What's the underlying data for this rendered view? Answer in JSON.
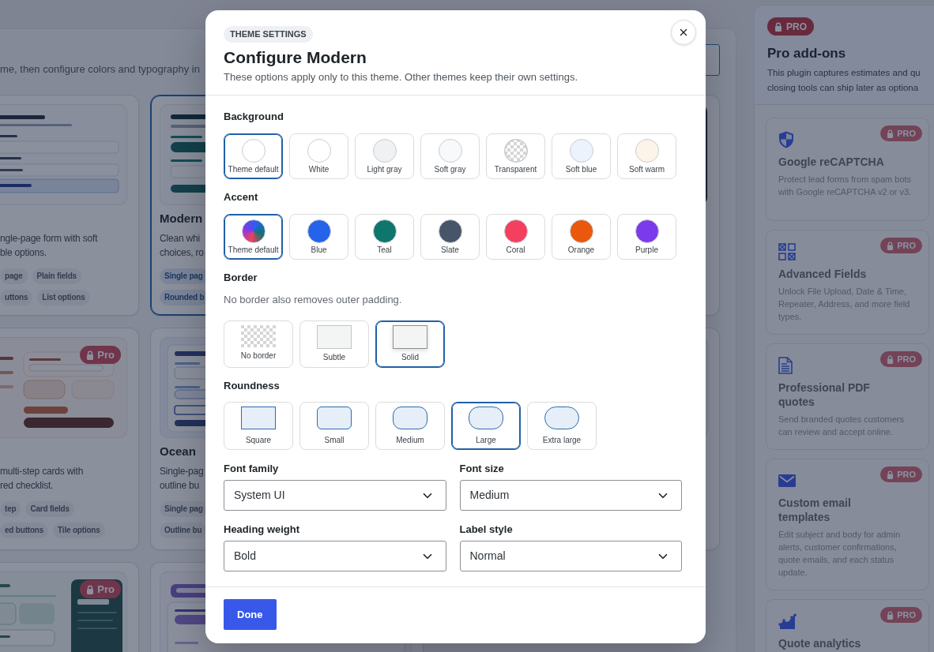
{
  "main_panel": {
    "intro": "me, then configure colors and typography in",
    "theme_cards": [
      {
        "kind": "plain",
        "selected": false,
        "description": "ngle-page form with soft\nble options.",
        "tag_rows": [
          [
            "page",
            "Plain fields"
          ],
          [
            "uttons",
            "List options"
          ]
        ]
      },
      {
        "kind": "modern",
        "selected": true,
        "title": "Modern",
        "description": "Clean whi\nchoices, ro",
        "tag_rows": [
          [
            "Single pag"
          ],
          [
            "Rounded b"
          ]
        ]
      },
      {
        "kind": "dark",
        "selected": false
      },
      {
        "kind": "warm",
        "selected": false,
        "badge": "Pro",
        "description": "multi-step cards with\nred checklist.",
        "tag_rows": [
          [
            "tep",
            "Card fields"
          ],
          [
            "ed buttons",
            "Tile options"
          ]
        ]
      },
      {
        "kind": "ocean",
        "selected": false,
        "title": "Ocean",
        "description": "Single-pag\noutline bu",
        "tag_rows": [
          [
            "Single pag"
          ],
          [
            "Outline bu"
          ]
        ]
      },
      {
        "kind": "light",
        "selected": false
      },
      {
        "kind": "green",
        "selected": false,
        "badge": "Pro"
      },
      {
        "kind": "purple",
        "selected": false
      }
    ]
  },
  "pro_panel": {
    "badge": "PRO",
    "title": "Pro add-ons",
    "description": "This plugin captures estimates and qu\nclosing tools can ship later as optiona",
    "addons": [
      {
        "badge": "PRO",
        "title": "Google reCAPTCHA",
        "description": "Protect lead forms from spam bots with Google reCAPTCHA v2 or v3."
      },
      {
        "badge": "PRO",
        "title": "Advanced Fields",
        "description": "Unlock File Upload, Date & Time, Repeater, Address, and more field types."
      },
      {
        "badge": "PRO",
        "title": "Professional PDF quotes",
        "description": "Send branded quotes customers can review and accept online."
      },
      {
        "badge": "PRO",
        "title": "Custom email templates",
        "description": "Edit subject and body for admin alerts, customer confirmations, quote emails, and each status update."
      },
      {
        "badge": "PRO",
        "title": "Quote analytics"
      }
    ]
  },
  "modal": {
    "badge": "THEME SETTINGS",
    "title": "Configure Modern",
    "subtitle": "These options apply only to this theme. Other themes keep their own settings.",
    "sections": [
      {
        "kind": "swatches",
        "label": "Background",
        "options": [
          {
            "kind": "solid",
            "label": "Theme default",
            "color": "#ffffff",
            "selected": true
          },
          {
            "kind": "solid",
            "label": "White",
            "color": "#ffffff",
            "selected": false
          },
          {
            "kind": "solid",
            "label": "Light gray",
            "color": "#f0f1f3",
            "selected": false
          },
          {
            "kind": "solid",
            "label": "Soft gray",
            "color": "#f8f9fb",
            "selected": false
          },
          {
            "kind": "checker",
            "label": "Transparent",
            "selected": false
          },
          {
            "kind": "solid",
            "label": "Soft blue",
            "color": "#edf3fd",
            "selected": false
          },
          {
            "kind": "solid",
            "label": "Soft warm",
            "color": "#fdf4e9",
            "selected": false
          }
        ]
      },
      {
        "kind": "swatches",
        "label": "Accent",
        "options": [
          {
            "kind": "gradient",
            "label": "Theme default",
            "selected": true
          },
          {
            "kind": "solid",
            "label": "Blue",
            "color": "#2563eb",
            "selected": false
          },
          {
            "kind": "solid",
            "label": "Teal",
            "color": "#0f766e",
            "selected": false
          },
          {
            "kind": "solid",
            "label": "Slate",
            "color": "#475569",
            "selected": false
          },
          {
            "kind": "solid",
            "label": "Coral",
            "color": "#f43f5e",
            "selected": false
          },
          {
            "kind": "solid",
            "label": "Orange",
            "color": "#ea580c",
            "selected": false
          },
          {
            "kind": "solid",
            "label": "Purple",
            "color": "#7c3aed",
            "selected": false
          }
        ]
      },
      {
        "kind": "frames",
        "label": "Border",
        "hint": "No border also removes outer padding.",
        "options": [
          {
            "kind": "none",
            "label": "No border",
            "selected": false
          },
          {
            "kind": "subtle",
            "label": "Subtle",
            "selected": false
          },
          {
            "kind": "solid",
            "label": "Solid",
            "selected": true
          }
        ]
      },
      {
        "kind": "shapes",
        "label": "Roundness",
        "options": [
          {
            "kind": "square",
            "label": "Square",
            "selected": false
          },
          {
            "kind": "small",
            "label": "Small",
            "selected": false
          },
          {
            "kind": "medium",
            "label": "Medium",
            "selected": false
          },
          {
            "kind": "large",
            "label": "Large",
            "selected": true
          },
          {
            "kind": "xlarge",
            "label": "Extra large",
            "selected": false
          }
        ]
      }
    ],
    "fields": [
      {
        "label": "Font family",
        "value": "System UI"
      },
      {
        "label": "Font size",
        "value": "Medium"
      },
      {
        "label": "Heading weight",
        "value": "Bold"
      },
      {
        "label": "Label style",
        "value": "Normal"
      }
    ],
    "done_button": "Done"
  }
}
